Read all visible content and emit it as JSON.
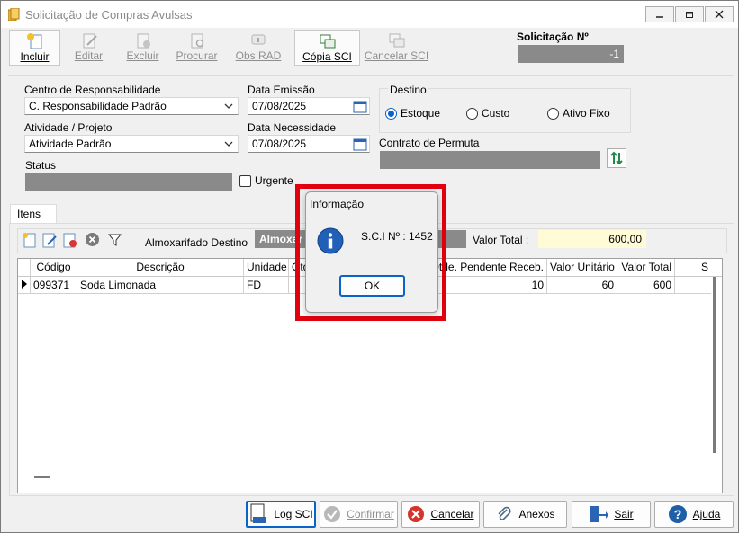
{
  "window": {
    "title": "Solicitação de Compras Avulsas"
  },
  "toolbar": {
    "incluir": "Incluir",
    "editar": "Editar",
    "excluir": "Excluir",
    "procurar": "Procurar",
    "obs_rad": "Obs RAD",
    "copia_sci": "Cópia SCI",
    "cancelar_sci": "Cancelar SCI"
  },
  "solicitacao": {
    "label": "Solicitação Nº",
    "value": "-1"
  },
  "form": {
    "centro_label": "Centro de Responsabilidade",
    "centro_value": "C. Responsabilidade Padrão",
    "atividade_label": "Atividade / Projeto",
    "atividade_value": "Atividade Padrão",
    "status_label": "Status",
    "status_value": "",
    "urgente_label": "Urgente",
    "data_emissao_label": "Data Emissão",
    "data_emissao_value": "07/08/2025",
    "data_necessidade_label": "Data Necessidade",
    "data_necessidade_value": "07/08/2025",
    "destino_label": "Destino",
    "destino_options": [
      "Estoque",
      "Custo",
      "Ativo Fixo"
    ],
    "destino_selected": "Estoque",
    "contrato_label": "Contrato de Permuta",
    "contrato_value": ""
  },
  "itens": {
    "tab_label": "Itens",
    "almox_label": "Almoxarifado Destino",
    "almox_value": "Almoxar",
    "valor_total_label": "Valor Total :",
    "valor_total_value": "600,00",
    "columns": [
      "Código",
      "Descrição",
      "Unidade",
      "Qtd",
      "Qtde. Pendente Receb.",
      "Valor Unitário",
      "Valor Total",
      "S"
    ],
    "rows": [
      {
        "codigo": "099371",
        "descricao": "Soda Limonada",
        "unidade": "FD",
        "qtd": "",
        "pendente": "10",
        "unitario": "60",
        "total": "600"
      }
    ]
  },
  "bottom": {
    "log": "Log SCI",
    "confirmar": "Confirmar",
    "cancelar": "Cancelar",
    "anexos": "Anexos",
    "sair": "Sair",
    "ajuda": "Ajuda"
  },
  "dialog": {
    "title": "Informação",
    "message": "S.C.I Nº : 1452",
    "ok": "OK"
  },
  "colors": {
    "accent": "#0a63c8",
    "highlight": "#e3000f",
    "total_bg": "#fefbd6",
    "disabled_field": "#8a8a8a"
  }
}
